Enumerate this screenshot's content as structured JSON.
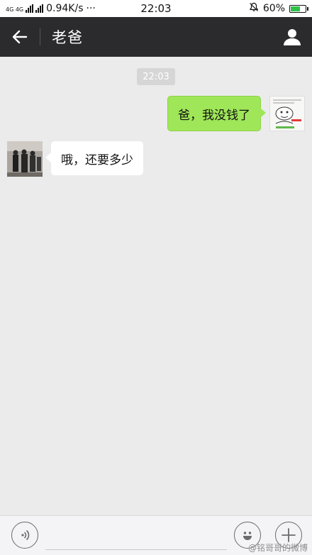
{
  "status_bar": {
    "network_label": "4G 4G",
    "speed": "0.94K/s",
    "more": "···",
    "time": "22:03",
    "battery": "60%",
    "battery_level": 0.6,
    "battery_color": "#2ec24a",
    "icons": [
      "signal-icon",
      "mute-bell-icon",
      "battery-icon"
    ]
  },
  "header": {
    "title": "老爸",
    "back_icon": "back-arrow-icon",
    "profile_icon": "user-profile-icon",
    "background": "#2b2b2d"
  },
  "chat": {
    "timestamp": "22:03",
    "messages": [
      {
        "side": "right",
        "text": "爸，我没钱了",
        "avatar": "meme-sticker-avatar"
      },
      {
        "side": "left",
        "text": "哦，还要多少",
        "avatar": "photo-avatar"
      }
    ],
    "bubble_green": "#9fe658"
  },
  "input_bar": {
    "voice_icon": "voice-icon",
    "emoji_icon": "emoji-icon",
    "plus_icon": "plus-icon",
    "watermark": "@铭哥哥的微博"
  }
}
